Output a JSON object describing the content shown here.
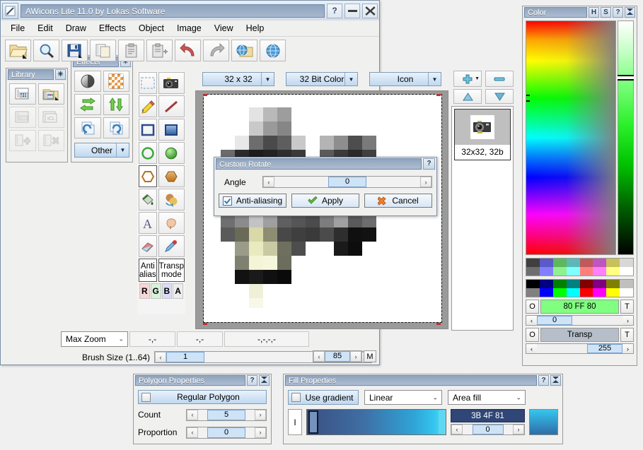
{
  "app": {
    "title": "AWicons Lite 11.0 by Lokas Software",
    "titlebar_buttons": [
      {
        "name": "help-button",
        "label": "?"
      },
      {
        "name": "minimize-button",
        "label": "—"
      },
      {
        "name": "close-button",
        "label": "✖"
      }
    ],
    "menu": [
      "File",
      "Edit",
      "Draw",
      "Effects",
      "Object",
      "Image",
      "View",
      "Help"
    ],
    "toolbar": [
      {
        "name": "open-file-button",
        "icon": "open-folder-icon"
      },
      {
        "name": "zoom-button",
        "icon": "magnifier-icon"
      },
      {
        "name": "save-button",
        "icon": "floppy-disk-icon"
      },
      {
        "name": "copy-page-button",
        "icon": "copy-page-icon"
      },
      {
        "name": "paste-button",
        "icon": "clipboard-icon"
      },
      {
        "name": "paste-new-button",
        "icon": "clipboard-plus-icon"
      },
      {
        "name": "undo-button",
        "icon": "undo-arrow-icon"
      },
      {
        "name": "redo-button",
        "icon": "redo-arrow-icon"
      },
      {
        "name": "open-web-button",
        "icon": "globe-folder-icon"
      },
      {
        "name": "web-button",
        "icon": "globe-icon"
      }
    ],
    "options": {
      "size": "32 x 32",
      "depth": "32 Bit Color",
      "format": "Icon",
      "add_label": "+",
      "remove_label": "—",
      "up_label": "▲",
      "down_label": "▼"
    },
    "icon_list": [
      {
        "label": "32x32, 32b",
        "name": "icon-list-item"
      }
    ],
    "statusbar": {
      "zoom": "Max Zoom",
      "coord1": "-,-",
      "coord2": "-,-",
      "coord3": "-,-,-,-",
      "brush_label": "Brush Size (1..64)",
      "brush_value": "1",
      "opacity_value": "85",
      "mode_label": "M"
    }
  },
  "dialog": {
    "title": "Custom Rotate",
    "help_label": "?",
    "angle_label": "Angle",
    "angle_value": "0",
    "antialias_label": "Anti-aliasing",
    "apply_label": "Apply",
    "cancel_label": "Cancel",
    "dec_label": "‹",
    "inc_label": "›"
  },
  "library": {
    "title": "Library",
    "close_label": "✳",
    "items": [
      {
        "name": "new-library-button",
        "icon": "library-new-icon"
      },
      {
        "name": "open-library-button",
        "icon": "library-open-icon"
      },
      {
        "name": "save-library-button",
        "icon": "library-save-icon"
      },
      {
        "name": "icl-library-button",
        "icon": "library-icl-icon"
      },
      {
        "name": "add-icon-button",
        "icon": "library-add-icon"
      },
      {
        "name": "delete-icon-button",
        "icon": "library-delete-icon"
      }
    ]
  },
  "effects": {
    "title": "Effects",
    "close_label": "✳",
    "items": [
      {
        "name": "contrast-effect-button",
        "icon": "contrast-sphere-icon"
      },
      {
        "name": "texture-effect-button",
        "icon": "checker-texture-icon"
      },
      {
        "name": "flip-horizontal-button",
        "icon": "flip-horizontal-icon"
      },
      {
        "name": "flip-vertical-button",
        "icon": "flip-vertical-icon"
      },
      {
        "name": "rotate-left-button",
        "icon": "rotate-left-icon"
      },
      {
        "name": "rotate-right-button",
        "icon": "rotate-right-icon"
      }
    ],
    "other_label": "Other"
  },
  "tools": {
    "items": [
      {
        "name": "select-tool",
        "icon": "marquee-select-icon"
      },
      {
        "name": "capture-tool",
        "icon": "camera-icon"
      },
      {
        "name": "pencil-tool",
        "icon": "pencil-icon"
      },
      {
        "name": "line-tool",
        "icon": "line-icon"
      },
      {
        "name": "rectangle-tool",
        "icon": "rectangle-outline-icon"
      },
      {
        "name": "filled-rectangle-tool",
        "icon": "rectangle-filled-icon"
      },
      {
        "name": "ellipse-tool",
        "icon": "ellipse-outline-icon"
      },
      {
        "name": "filled-ellipse-tool",
        "icon": "ellipse-filled-icon"
      },
      {
        "name": "polygon-tool",
        "icon": "polygon-outline-icon"
      },
      {
        "name": "filled-polygon-tool",
        "icon": "polygon-filled-icon"
      },
      {
        "name": "fill-tool",
        "icon": "paint-bucket-icon"
      },
      {
        "name": "replace-color-tool",
        "icon": "replace-color-icon"
      },
      {
        "name": "text-tool",
        "icon": "text-a-icon"
      },
      {
        "name": "smudge-tool",
        "icon": "smudge-finger-icon"
      },
      {
        "name": "eraser-tool",
        "icon": "eraser-icon"
      },
      {
        "name": "eyedropper-tool",
        "icon": "eyedropper-icon"
      }
    ],
    "antialias_label": "Anti\nalias",
    "antialias_line1": "Anti",
    "antialias_line2": "alias",
    "transp_line1": "Transp",
    "transp_line2": "mode",
    "channels": [
      {
        "label": "R",
        "name": "channel-r-button",
        "color": "#f7d6d6"
      },
      {
        "label": "G",
        "name": "channel-g-button",
        "color": "#d9f2d9"
      },
      {
        "label": "B",
        "name": "channel-b-button",
        "color": "#dcdcf7"
      },
      {
        "label": "A",
        "name": "channel-a-button",
        "color": "#ededed"
      }
    ]
  },
  "color_panel": {
    "title": "Color",
    "buttons": [
      {
        "name": "hue-mode-button",
        "label": "H"
      },
      {
        "name": "saturation-mode-button",
        "label": "S"
      },
      {
        "name": "help-button",
        "label": "?"
      },
      {
        "name": "collapse-button",
        "label": "⧖"
      }
    ],
    "foreground": {
      "o_label": "O",
      "value": "80 FF 80",
      "swatch": "#80FF80",
      "t_label": "T",
      "slider_value": "0"
    },
    "background": {
      "o_label": "O",
      "value": "Transp",
      "swatch": "#b6bfc9",
      "t_label": "T",
      "slider_value": "255"
    },
    "palette_top": [
      "#3f3f3f",
      "#5a5ac8",
      "#5cb85c",
      "#5ab8b8",
      "#c05a5a",
      "#c055c0",
      "#c8c05a",
      "#d8d8d8",
      "#6e6e6e",
      "#8080ff",
      "#90f090",
      "#80ffff",
      "#ff7f7f",
      "#ff7fff",
      "#ffff80",
      "#ffffff"
    ],
    "palette_bottom": [
      "#000000",
      "#000080",
      "#008000",
      "#008080",
      "#800000",
      "#800080",
      "#808000",
      "#c0c0c0",
      "#808080",
      "#0000ff",
      "#00ff00",
      "#00ffff",
      "#ff0000",
      "#ff00ff",
      "#ffff00",
      "#ffffff"
    ],
    "dec_label": "‹",
    "inc_label": "›"
  },
  "polygon_properties": {
    "title": "Polygon Properties",
    "help_label": "?",
    "collapse_label": "⧖",
    "regular_label": "Regular Polygon",
    "count_label": "Count",
    "count_value": "5",
    "proportion_label": "Proportion",
    "proportion_value": "0",
    "dec_label": "‹",
    "inc_label": "›"
  },
  "fill_properties": {
    "title": "Fill Properties",
    "help_label": "?",
    "collapse_label": "⧖",
    "use_gradient_label": "Use gradient",
    "gradient_type": "Linear",
    "fill_mode": "Area fill",
    "stop_color_value": "3B 4F 81",
    "stop_position": "0",
    "gradient_start": "#3B4F81",
    "gradient_end": "#35c6ee",
    "preview_top": "#35c6ee",
    "preview_bottom": "#2f6ca8",
    "marker_label": "I",
    "dec_label": "‹",
    "inc_label": "›"
  }
}
